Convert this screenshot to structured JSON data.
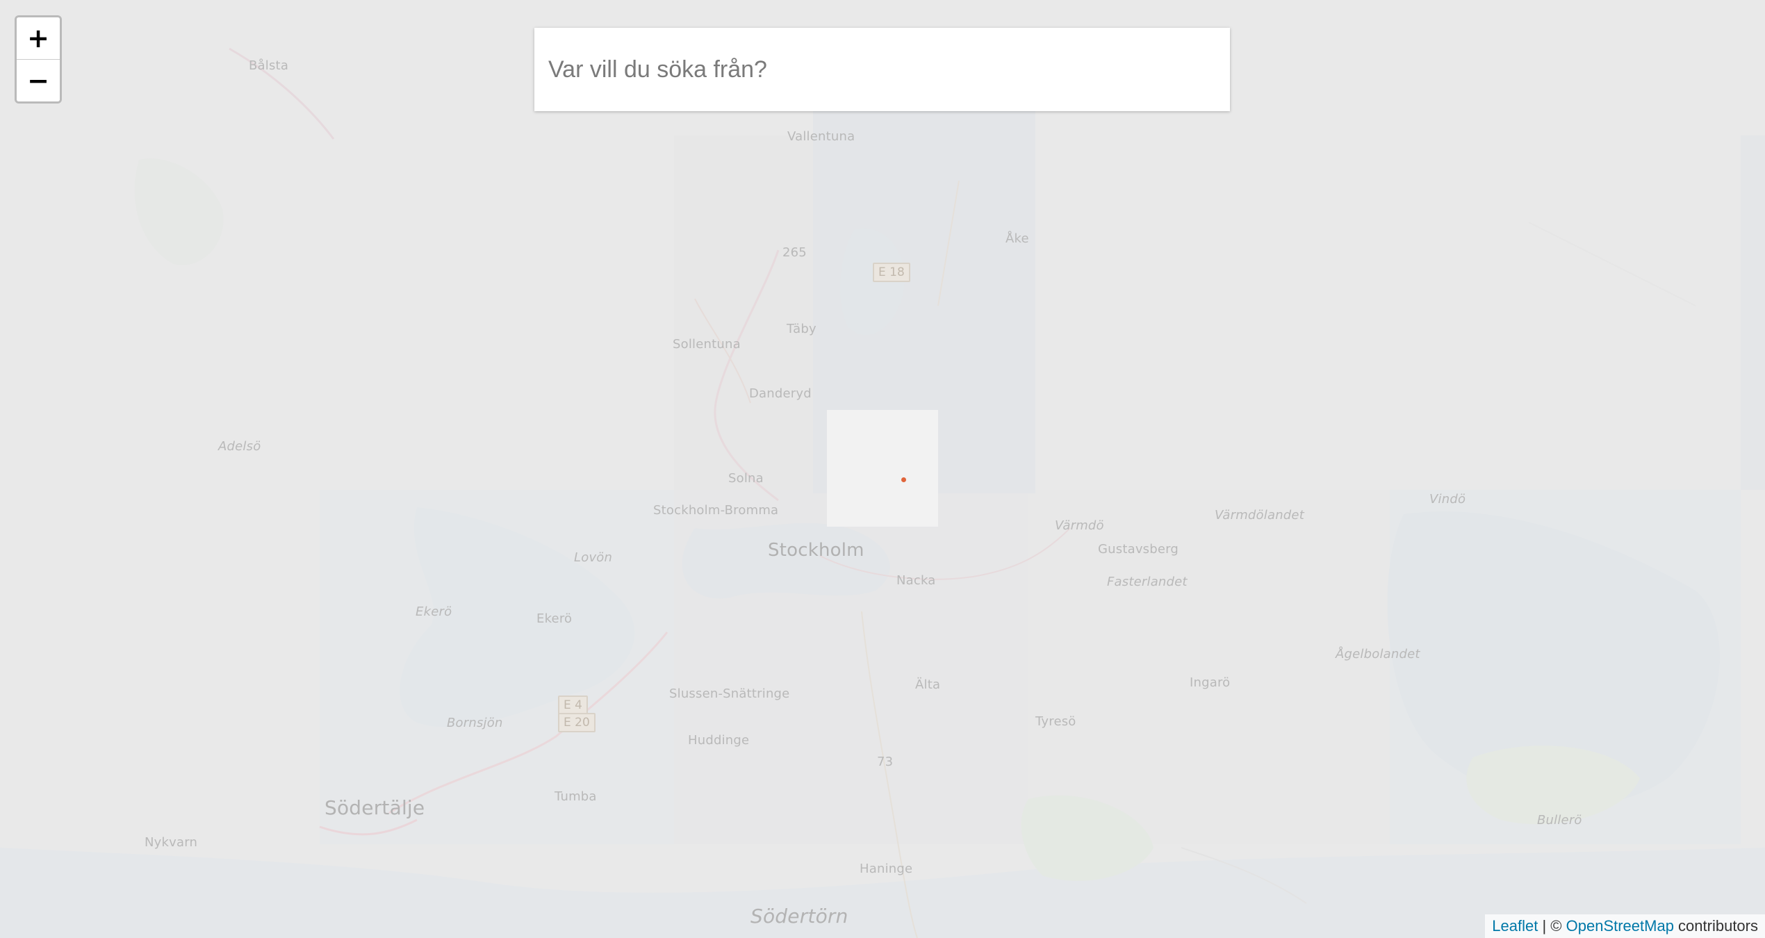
{
  "zoom": {
    "in_label": "+",
    "out_label": "−"
  },
  "search": {
    "placeholder": "Var vill du söka från?"
  },
  "map": {
    "labels": [
      "Bålsta",
      "Vallentuna",
      "Åke",
      "Täby",
      "Danderyd",
      "Solna",
      "Stockholm",
      "Värmdö",
      "Gustavsberg",
      "Värmdölandet",
      "Fasterlandet",
      "Vindö",
      "Lovön",
      "Ekerö",
      "Ekerö",
      "Bornsjön",
      "Södertälje",
      "Tumba",
      "Huddinge",
      "Älta",
      "Tyresö",
      "Nacka",
      "Ingarö",
      "Nykvarn",
      "Södertörn",
      "Bullerö",
      "Sollentuna",
      "Adelsö",
      "Slussen-Snättringe",
      "Stockholm-Bromma",
      "Ågelbolandet",
      "Haninge"
    ],
    "shields": [
      "E 18",
      "E 4",
      "E 20",
      "265",
      "73"
    ],
    "location_marker_color": "#e0643a"
  },
  "attribution": {
    "leaflet_link": "Leaflet",
    "separator": " | © ",
    "osm_link": "OpenStreetMap",
    "suffix": " contributors"
  }
}
